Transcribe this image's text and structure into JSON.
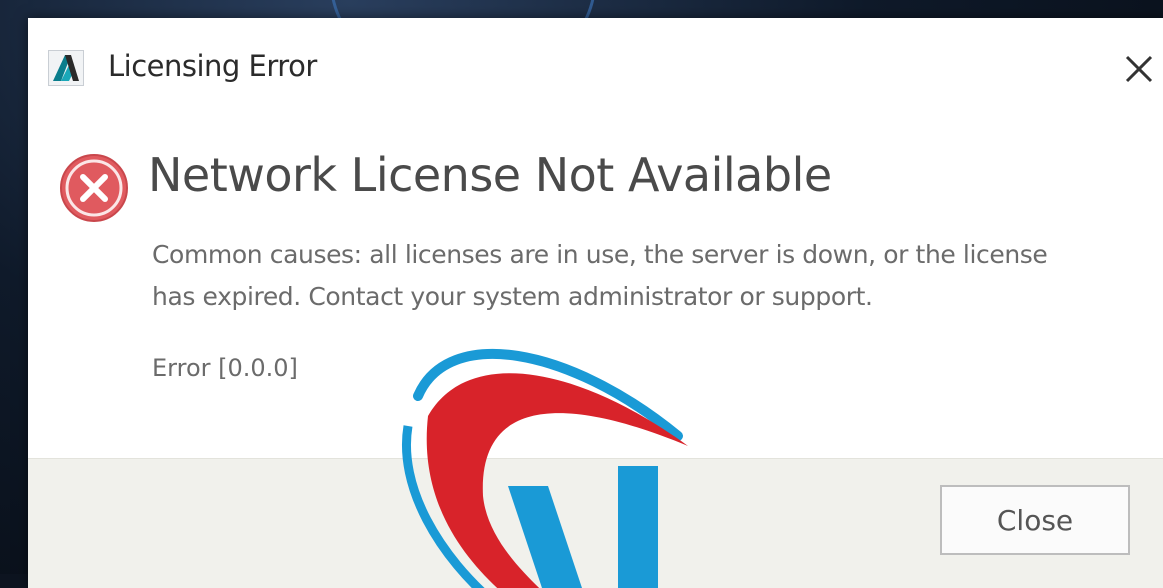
{
  "dialog": {
    "title": "Licensing Error",
    "app_icon": "autodesk-logo-icon",
    "close_icon": "close-icon"
  },
  "content": {
    "error_icon": "error-icon",
    "heading": "Network License Not Available",
    "description_line1": "Common causes: all licenses are in use, the server is down, or the license",
    "description_line2": "has expired. Contact your system administrator or support.",
    "error_code": "Error [0.0.0]"
  },
  "footer": {
    "close_label": "Close"
  },
  "colors": {
    "error_red": "#e05a5f",
    "dialog_bg": "#ffffff",
    "footer_bg": "#f1f1ec",
    "watermark_red": "#d8232a",
    "watermark_blue": "#1a9ad6"
  }
}
